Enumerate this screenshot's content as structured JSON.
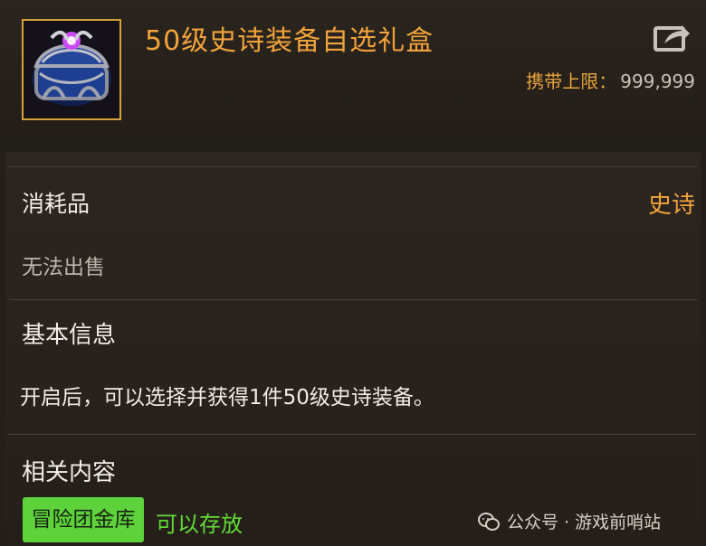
{
  "item": {
    "title": "50级史诗装备自选礼盒",
    "carry_limit_label": "携带上限：",
    "carry_limit_value": "999,999",
    "category": "消耗品",
    "rarity": "史诗",
    "sell_note": "无法出售",
    "icon": "gift-chest-icon"
  },
  "basic_info": {
    "title": "基本信息",
    "description": "开启后，可以选择并获得1件50级史诗装备。"
  },
  "related": {
    "title": "相关内容",
    "tag_label": "冒险团金库",
    "tag_status": "可以存放"
  },
  "watermark": {
    "text": "公众号 · 游戏前哨站",
    "icon": "wechat-icon"
  },
  "colors": {
    "title": "#f2a33b",
    "rarity": "#f2a33b",
    "tag_bg": "#5ed23b",
    "tag_status": "#62da36",
    "background": "#231e17"
  }
}
